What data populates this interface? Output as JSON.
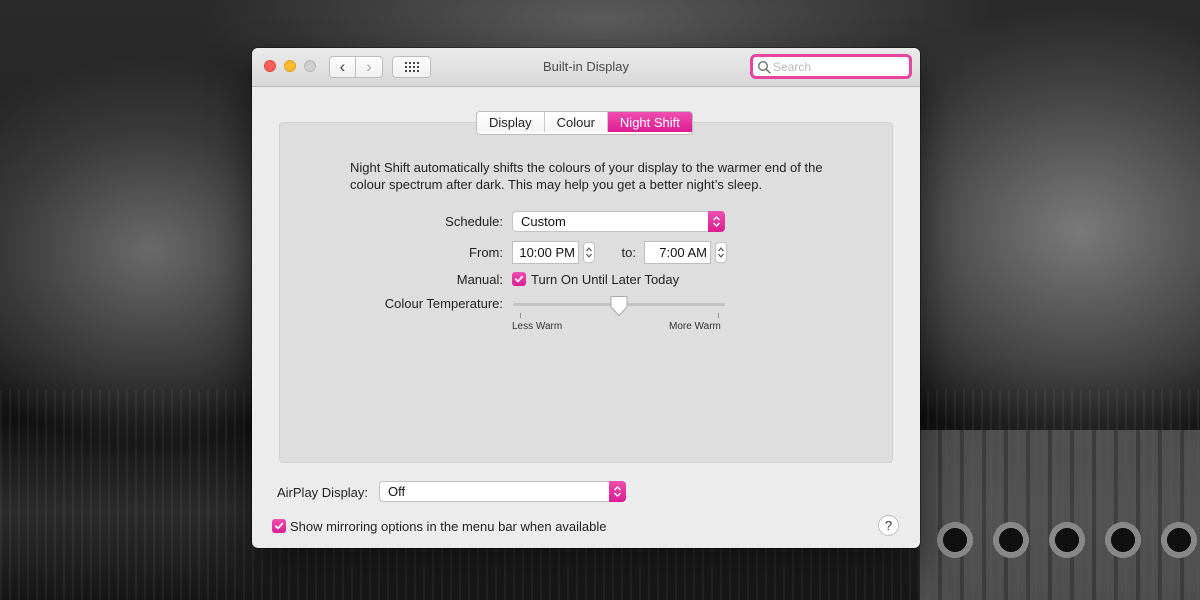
{
  "window": {
    "title": "Built-in Display"
  },
  "toolbar": {
    "back_icon": "‹",
    "forward_icon": "›",
    "search_placeholder": "Search"
  },
  "tabs": [
    {
      "label": "Display",
      "active": false
    },
    {
      "label": "Colour",
      "active": false
    },
    {
      "label": "Night Shift",
      "active": true
    }
  ],
  "night_shift": {
    "description": "Night Shift automatically shifts the colours of your display to the warmer end of the colour spectrum after dark. This may help you get a better night’s sleep.",
    "schedule_label": "Schedule:",
    "schedule_value": "Custom",
    "from_label": "From:",
    "from_value": "10:00 PM",
    "to_label": "to:",
    "to_value": "7:00 AM",
    "manual_label": "Manual:",
    "manual_checkbox_label": "Turn On Until Later Today",
    "manual_checked": true,
    "colour_temp_label": "Colour Temperature:",
    "colour_temp_value": 0.5,
    "less_warm_label": "Less Warm",
    "more_warm_label": "More Warm"
  },
  "airplay": {
    "label": "AirPlay Display:",
    "value": "Off"
  },
  "mirroring": {
    "label": "Show mirroring options in the menu bar when available",
    "checked": true
  },
  "help_label": "?",
  "colors": {
    "accent": "#e2299b",
    "search_focus": "#e8449f"
  }
}
